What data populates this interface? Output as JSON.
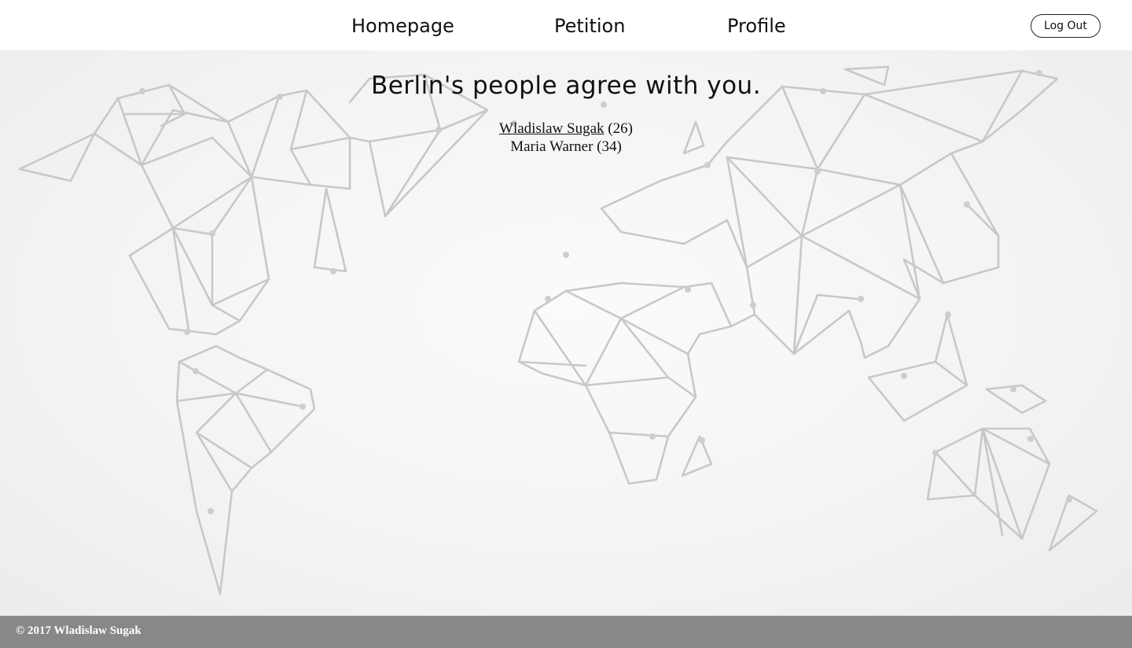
{
  "nav": {
    "items": [
      {
        "label": "Homepage"
      },
      {
        "label": "Petition"
      },
      {
        "label": "Profile"
      }
    ],
    "logout_label": "Log Out"
  },
  "main": {
    "headline": "Berlin's people agree with you.",
    "signers": [
      {
        "name": "Wladislaw Sugak",
        "age_text": "(26)",
        "linked": true
      },
      {
        "name": "Maria Warner",
        "age_text": "(34)",
        "linked": false
      }
    ]
  },
  "footer": {
    "copyright": "© 2017 Wladislaw Sugak"
  },
  "colors": {
    "header_bg": "#ffffff",
    "footer_bg": "#888888",
    "map_line": "#c8c8c8",
    "text": "#111111"
  }
}
